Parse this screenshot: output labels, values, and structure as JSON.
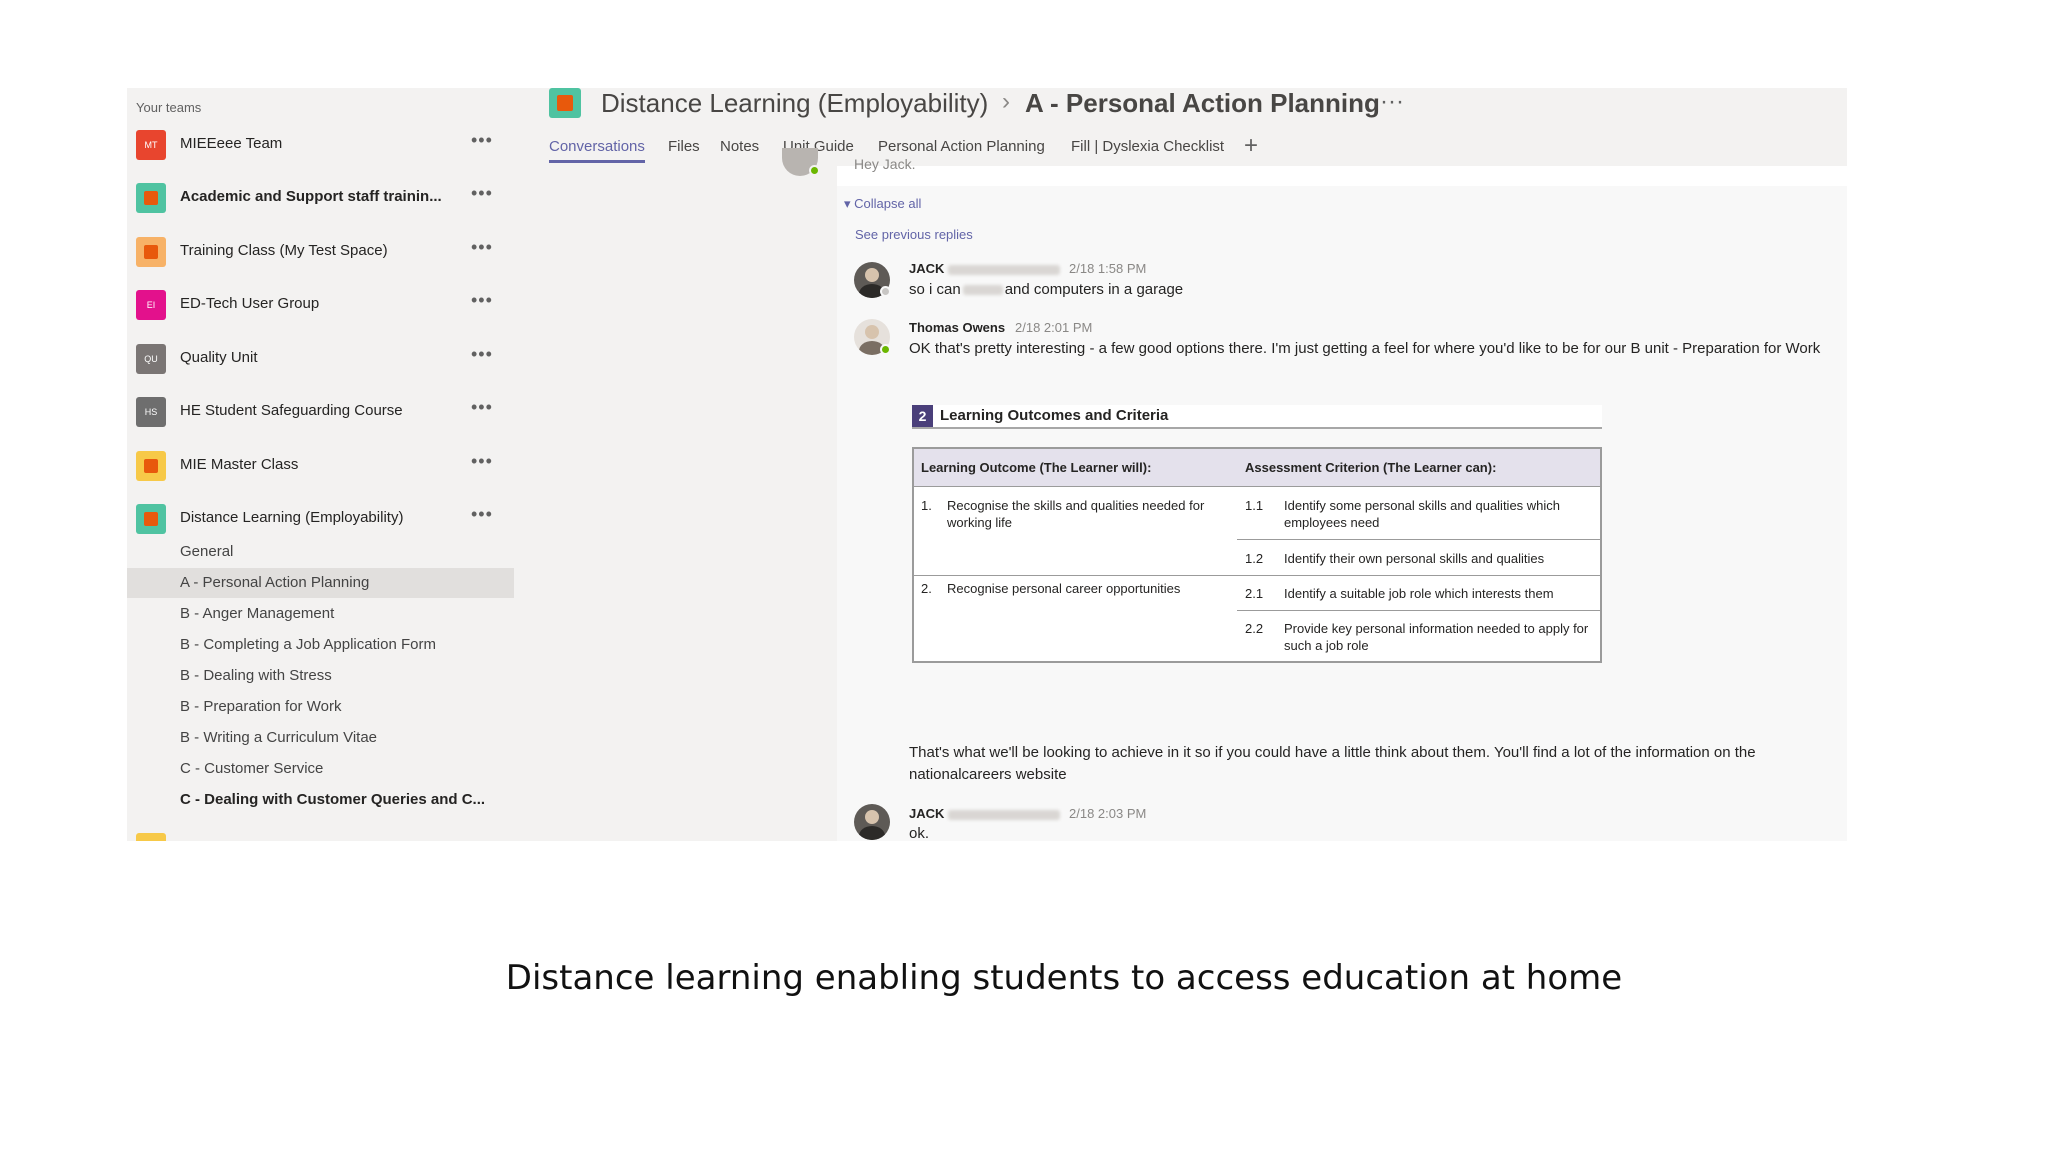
{
  "sidebar": {
    "heading": "Your teams",
    "teams": [
      {
        "name": "MIEEeee Team",
        "initials": "MT",
        "color": "#e8452e",
        "bold": false
      },
      {
        "name": "Academic and Support staff trainin...",
        "initials": "",
        "color": "#4fc3a1",
        "bold": true
      },
      {
        "name": "Training Class (My Test Space)",
        "initials": "",
        "color": "#f7b267",
        "bold": false
      },
      {
        "name": "ED-Tech User Group",
        "initials": "EI",
        "color": "#e3118c",
        "bold": false
      },
      {
        "name": "Quality Unit",
        "initials": "QU",
        "color": "#7a7574",
        "bold": false
      },
      {
        "name": "HE Student Safeguarding Course",
        "initials": "HS",
        "color": "#6e6e6e",
        "bold": false
      },
      {
        "name": "MIE Master Class",
        "initials": "",
        "color": "#f7c948",
        "bold": false
      },
      {
        "name": "Distance Learning (Employability)",
        "initials": "",
        "color": "#4fc3a1",
        "bold": false
      }
    ],
    "more_label": "•••",
    "channels": [
      {
        "name": "General",
        "active": false,
        "bold": false
      },
      {
        "name": "A - Personal Action Planning",
        "active": true,
        "bold": false
      },
      {
        "name": "B - Anger Management",
        "active": false,
        "bold": false
      },
      {
        "name": "B - Completing a Job Application Form",
        "active": false,
        "bold": false
      },
      {
        "name": "B - Dealing with Stress",
        "active": false,
        "bold": false
      },
      {
        "name": "B - Preparation for Work",
        "active": false,
        "bold": false
      },
      {
        "name": "B - Writing a Curriculum Vitae",
        "active": false,
        "bold": false
      },
      {
        "name": "C - Customer Service",
        "active": false,
        "bold": false
      },
      {
        "name": "C - Dealing with Customer Queries and C...",
        "active": false,
        "bold": true
      }
    ]
  },
  "header": {
    "team": "Distance Learning (Employability)",
    "separator": "›",
    "channel": "A - Personal Action Planning",
    "more": "···",
    "tabs": [
      "Conversations",
      "Files",
      "Notes",
      "Unit Guide",
      "Personal Action Planning",
      "Fill | Dyslexia Checklist"
    ],
    "add_tab": "+"
  },
  "conversation": {
    "partial_message": "Hey Jack.",
    "collapse_all": "Collapse all",
    "see_previous": "See previous replies",
    "messages": [
      {
        "author": "JACK",
        "time": "2/18 1:58 PM",
        "text_start": "so i can",
        "text_end": "and computers in a garage"
      },
      {
        "author": "Thomas Owens",
        "time": "2/18 2:01 PM",
        "text": "OK that's pretty interesting - a few good options there. I'm just getting a feel for where you'd like to be for our B unit - Preparation for Work",
        "followup": "That's what we'll be looking to achieve in it so if you could have a little think about them. You'll find a lot of the information on the nationalcareers website"
      },
      {
        "author": "JACK",
        "time": "2/18 2:03 PM",
        "text": "ok."
      }
    ],
    "status_colors": {
      "online": "#6bb700",
      "away": "#c8c6c4"
    }
  },
  "outcomes_table": {
    "section_number": "2",
    "section_title": "Learning Outcomes and Criteria",
    "col1_header": "Learning Outcome (The Learner will):",
    "col2_header": "Assessment Criterion (The Learner can):",
    "rows": [
      {
        "num": "1.",
        "outcome": "Recognise the skills and qualities needed for working life",
        "criteria": [
          {
            "num": "1.1",
            "text": "Identify some personal skills and qualities which employees need"
          },
          {
            "num": "1.2",
            "text": "Identify their own personal skills and qualities"
          }
        ]
      },
      {
        "num": "2.",
        "outcome": "Recognise personal career opportunities",
        "criteria": [
          {
            "num": "2.1",
            "text": "Identify a suitable job role which interests them"
          },
          {
            "num": "2.2",
            "text": "Provide key personal information needed to apply for such a job role"
          }
        ]
      }
    ]
  },
  "caption": "Distance learning enabling students to access education at home"
}
